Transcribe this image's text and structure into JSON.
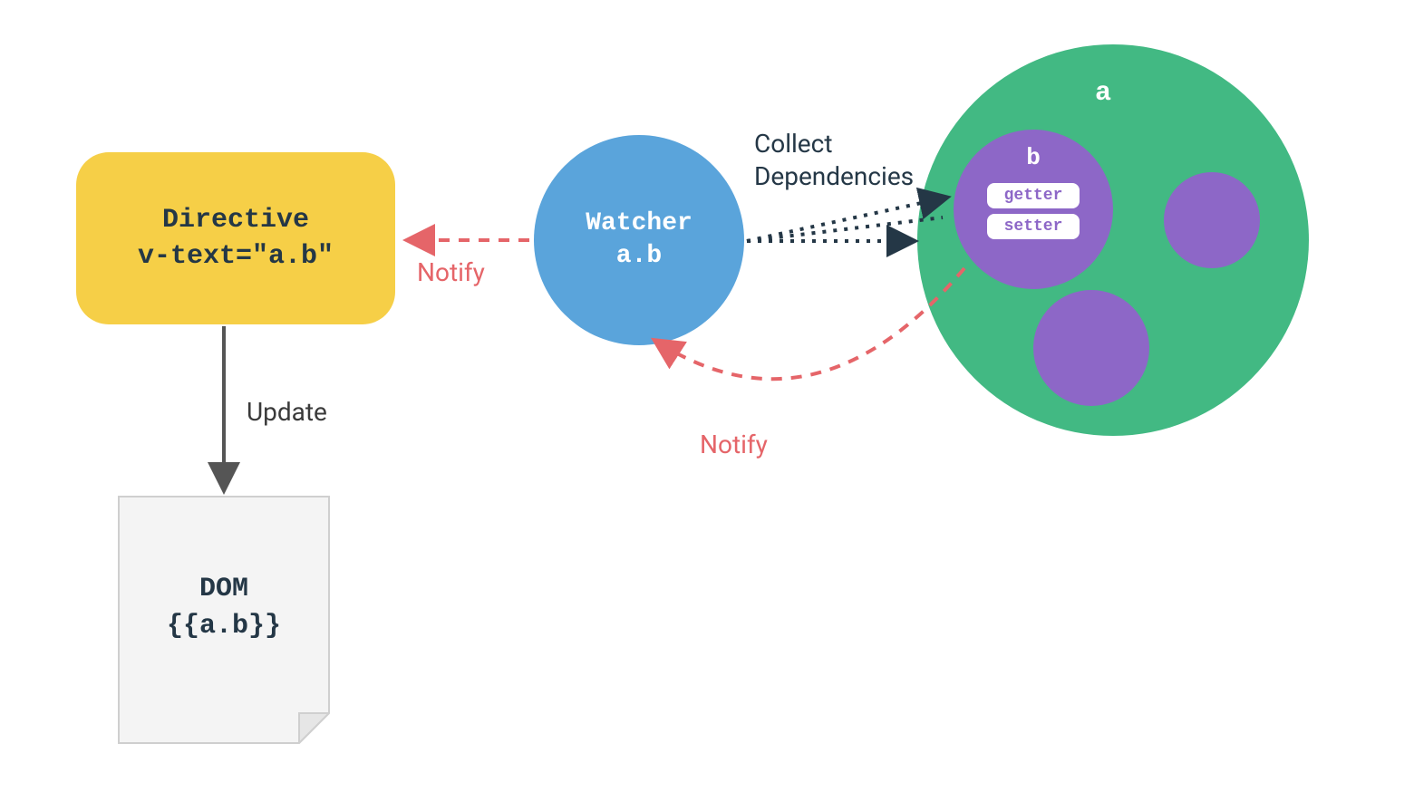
{
  "directive": {
    "title": "Directive",
    "code": "v-text=\"a.b\""
  },
  "watcher": {
    "title": "Watcher",
    "target": "a.b"
  },
  "data_object": {
    "a_label": "a",
    "b_label": "b",
    "getter_label": "getter",
    "setter_label": "setter"
  },
  "dom": {
    "title": "DOM",
    "template": "{{a.b}}"
  },
  "labels": {
    "update": "Update",
    "notify_left": "Notify",
    "notify_bottom": "Notify",
    "collect_line1": "Collect",
    "collect_line2": "Dependencies"
  },
  "colors": {
    "yellow": "#f6cf47",
    "blue": "#5aa4db",
    "green": "#42b983",
    "purple": "#8d67c7",
    "red": "#e56569",
    "dark": "#243746",
    "gray_fill": "#f4f4f4",
    "gray_stroke": "#cfcfcf"
  }
}
